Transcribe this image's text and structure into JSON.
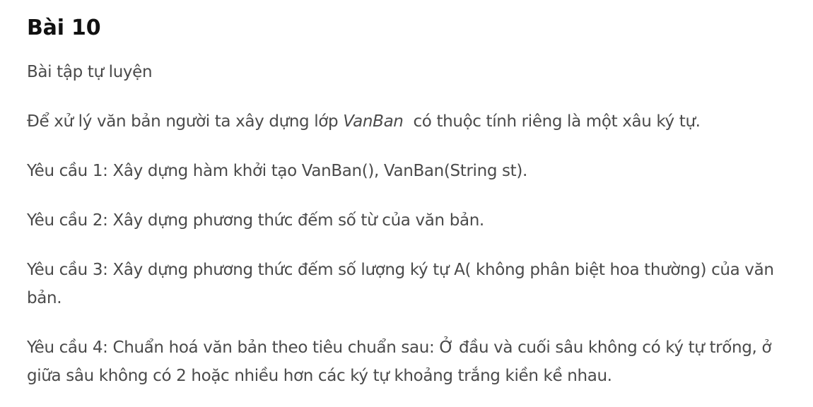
{
  "heading": "Bài 10",
  "subtitle": "Bài tập tự luyện",
  "intro": {
    "before": "Để xử lý văn bản người ta xây dựng lớp ",
    "class_name": "VanBan",
    "after": "  có thuộc tính riêng là một xâu ký tự."
  },
  "requirements": [
    "Yêu cầu 1: Xây dựng hàm khởi tạo VanBan(), VanBan(String st).",
    "Yêu cầu 2: Xây dựng phương thức đếm số từ của văn bản.",
    "Yêu cầu 3: Xây dựng phương thức đếm số lượng ký tự A( không phân biệt hoa thường) của văn bản.",
    "Yêu cầu 4: Chuẩn hoá văn bản theo tiêu chuẩn sau: Ở đầu và cuối sâu không có ký tự trống, ở giữa sâu không có 2 hoặc nhiều hơn các ký tự khoảng trắng kiền kề nhau."
  ]
}
